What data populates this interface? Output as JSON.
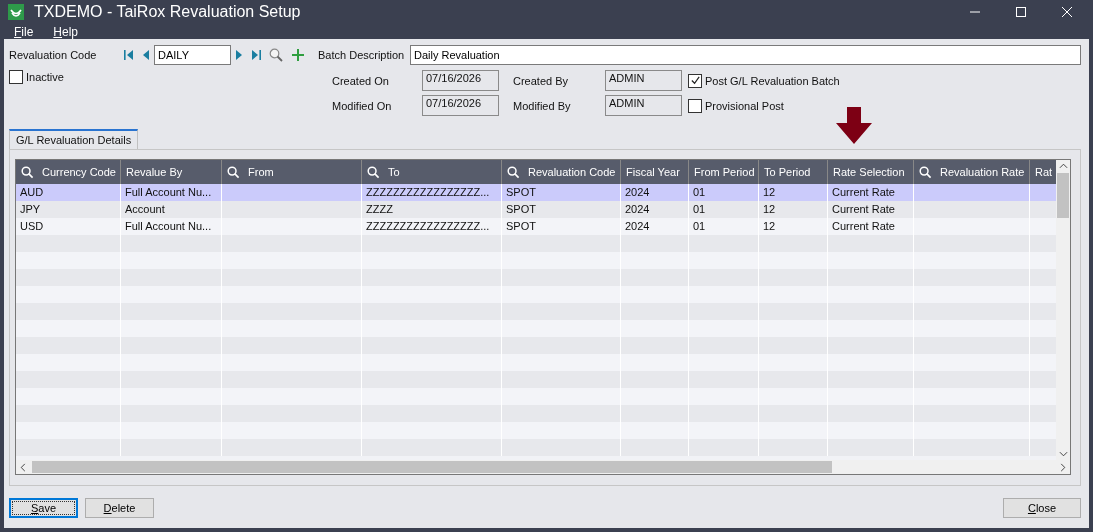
{
  "window": {
    "title": "TXDEMO - TaiRox Revaluation Setup"
  },
  "menu": [
    {
      "label": "File"
    },
    {
      "label": "Help"
    }
  ],
  "form": {
    "revaluation_code": {
      "label": "Revaluation Code",
      "value": "DAILY"
    },
    "batch_description": {
      "label": "Batch Description",
      "value": "Daily Revaluation"
    },
    "inactive": {
      "label": "Inactive",
      "checked": false
    },
    "created_on": {
      "label": "Created On",
      "value": "07/16/2026"
    },
    "created_by": {
      "label": "Created By",
      "value": "ADMIN"
    },
    "modified_on": {
      "label": "Modified On",
      "value": "07/16/2026"
    },
    "modified_by": {
      "label": "Modified By",
      "value": "ADMIN"
    },
    "post_batch": {
      "label": "Post G/L Revaluation Batch",
      "checked": true
    },
    "provisional_post": {
      "label": "Provisional Post",
      "checked": false
    }
  },
  "tabs": [
    {
      "label": "G/L Revaluation Details",
      "selected": true
    }
  ],
  "table": {
    "columns": [
      {
        "label": "Currency Code",
        "search": true
      },
      {
        "label": "Revalue By",
        "search": false
      },
      {
        "label": "From",
        "search": true
      },
      {
        "label": "To",
        "search": true
      },
      {
        "label": "Revaluation Code",
        "search": true
      },
      {
        "label": "Fiscal Year",
        "search": false
      },
      {
        "label": "From Period",
        "search": false
      },
      {
        "label": "To Period",
        "search": false
      },
      {
        "label": "Rate Selection",
        "search": false
      },
      {
        "label": "Revaluation Rate",
        "search": true
      },
      {
        "label": "Rat",
        "search": false
      }
    ],
    "rows": [
      {
        "selected": true,
        "cells": [
          "AUD",
          "Full Account Nu...",
          "",
          "ZZZZZZZZZZZZZZZZZ...",
          "SPOT",
          "2024",
          "01",
          "12",
          "Current Rate",
          "",
          ""
        ]
      },
      {
        "selected": false,
        "cells": [
          "JPY",
          "Account",
          "",
          "ZZZZ",
          "SPOT",
          "2024",
          "01",
          "12",
          "Current Rate",
          "",
          ""
        ]
      },
      {
        "selected": false,
        "cells": [
          "USD",
          "Full Account Nu...",
          "",
          "ZZZZZZZZZZZZZZZZZ...",
          "SPOT",
          "2024",
          "01",
          "12",
          "Current Rate",
          "",
          ""
        ]
      }
    ]
  },
  "buttons": [
    {
      "label": "Save",
      "default": true
    },
    {
      "label": "Delete",
      "default": false
    }
  ],
  "close_button": {
    "label": "Close"
  }
}
